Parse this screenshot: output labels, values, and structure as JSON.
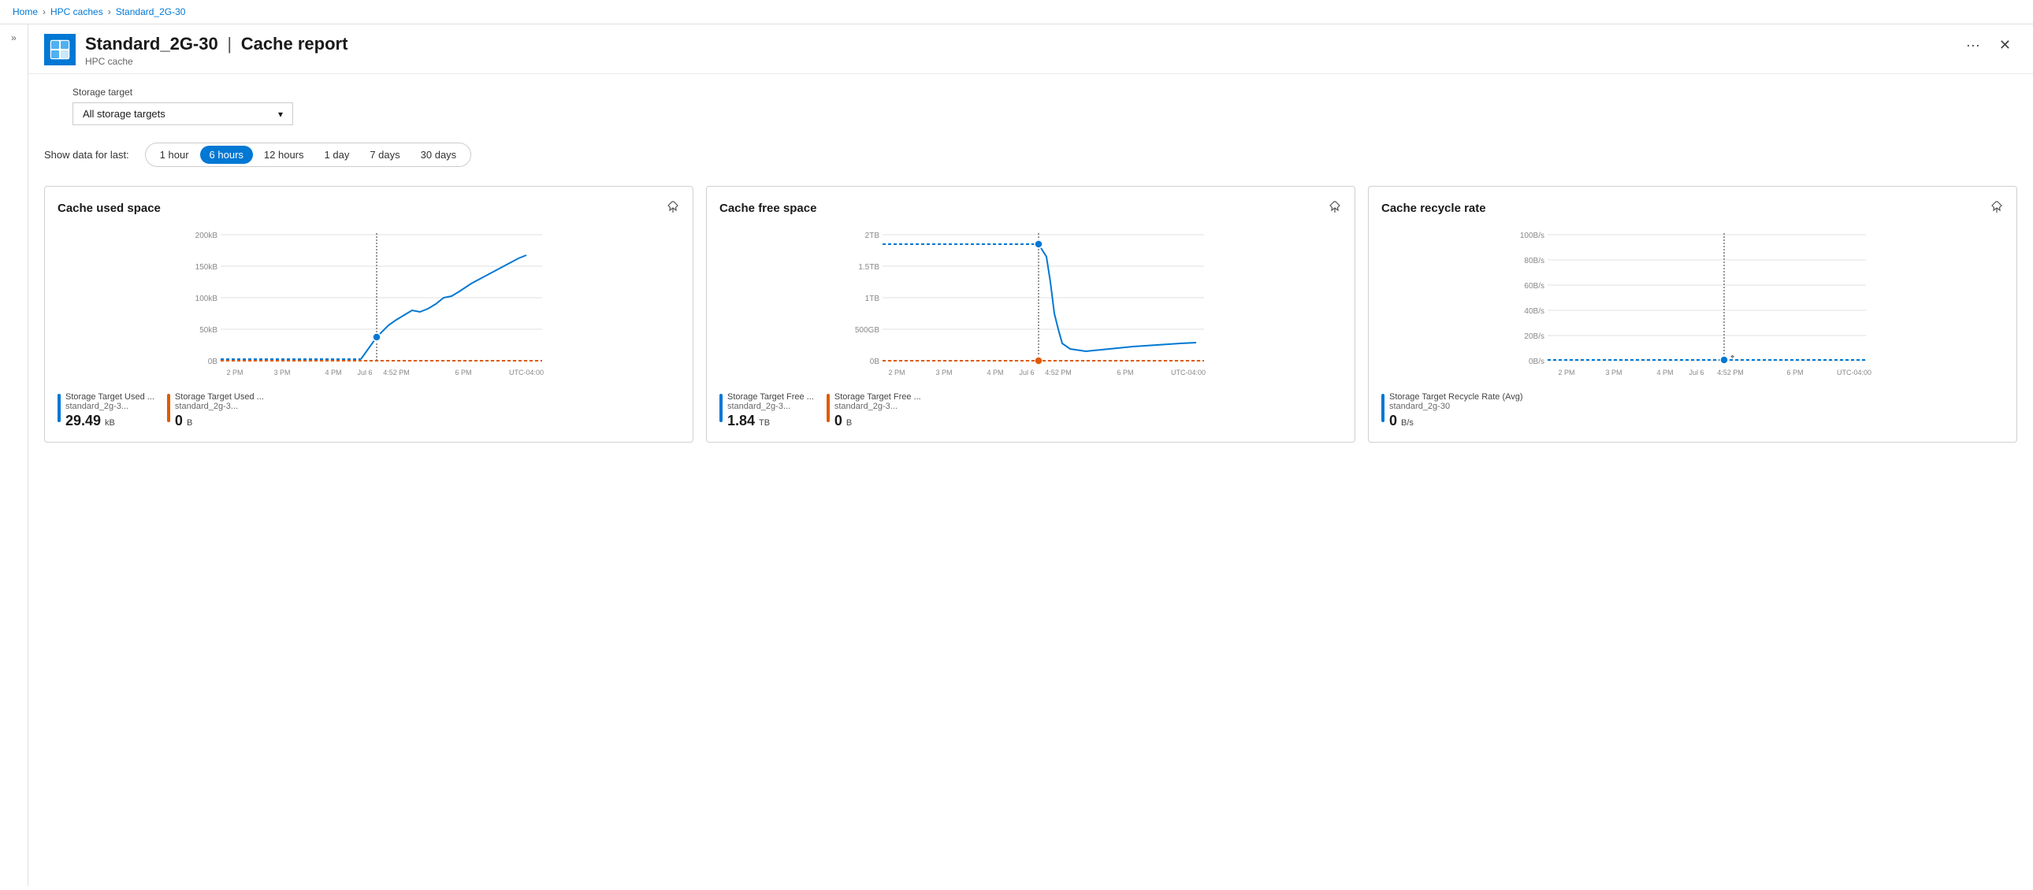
{
  "breadcrumb": {
    "items": [
      "Home",
      "HPC caches",
      "Standard_2G-30"
    ]
  },
  "header": {
    "title": "Standard_2G-30",
    "separator": "|",
    "subtitle_suffix": "Cache report",
    "page_type": "HPC cache",
    "ellipsis": "...",
    "close": "×"
  },
  "filter": {
    "label": "Storage target",
    "selected": "All storage targets",
    "chevron": "▾"
  },
  "time_filter": {
    "label": "Show data for last:",
    "options": [
      "1 hour",
      "6 hours",
      "12 hours",
      "1 day",
      "7 days",
      "30 days"
    ],
    "active_index": 1
  },
  "charts": [
    {
      "title": "Cache used space",
      "pin_label": "📌",
      "y_labels": [
        "200kB",
        "150kB",
        "100kB",
        "50kB",
        "0B"
      ],
      "x_labels": [
        "2 PM",
        "3 PM",
        "4 PM",
        "Jul 6",
        "4:52 PM",
        "6 PM",
        "UTC-04:00"
      ],
      "legend": [
        {
          "color": "#0078d4",
          "title": "Storage Target Used ...",
          "subtitle": "standard_2g-3...",
          "value": "29.49",
          "unit": "kB"
        },
        {
          "color": "#e05a00",
          "title": "Storage Target Used ...",
          "subtitle": "standard_2g-3...",
          "value": "0",
          "unit": "B"
        }
      ]
    },
    {
      "title": "Cache free space",
      "pin_label": "📌",
      "y_labels": [
        "2TB",
        "1.5TB",
        "1TB",
        "500GB",
        "0B"
      ],
      "x_labels": [
        "2 PM",
        "3 PM",
        "4 PM",
        "Jul 6",
        "4:52 PM",
        "6 PM",
        "UTC-04:00"
      ],
      "legend": [
        {
          "color": "#0078d4",
          "title": "Storage Target Free ...",
          "subtitle": "standard_2g-3...",
          "value": "1.84",
          "unit": "TB"
        },
        {
          "color": "#e05a00",
          "title": "Storage Target Free ...",
          "subtitle": "standard_2g-3...",
          "value": "0",
          "unit": "B"
        }
      ]
    },
    {
      "title": "Cache recycle rate",
      "pin_label": "📌",
      "y_labels": [
        "100B/s",
        "80B/s",
        "60B/s",
        "40B/s",
        "20B/s",
        "0B/s"
      ],
      "x_labels": [
        "2 PM",
        "3 PM",
        "4 PM",
        "Jul 6",
        "4:52 PM",
        "6 PM",
        "UTC-04:00"
      ],
      "legend": [
        {
          "color": "#0078d4",
          "title": "Storage Target Recycle Rate (Avg)",
          "subtitle": "standard_2g-30",
          "value": "0",
          "unit": "B/s"
        }
      ]
    }
  ]
}
